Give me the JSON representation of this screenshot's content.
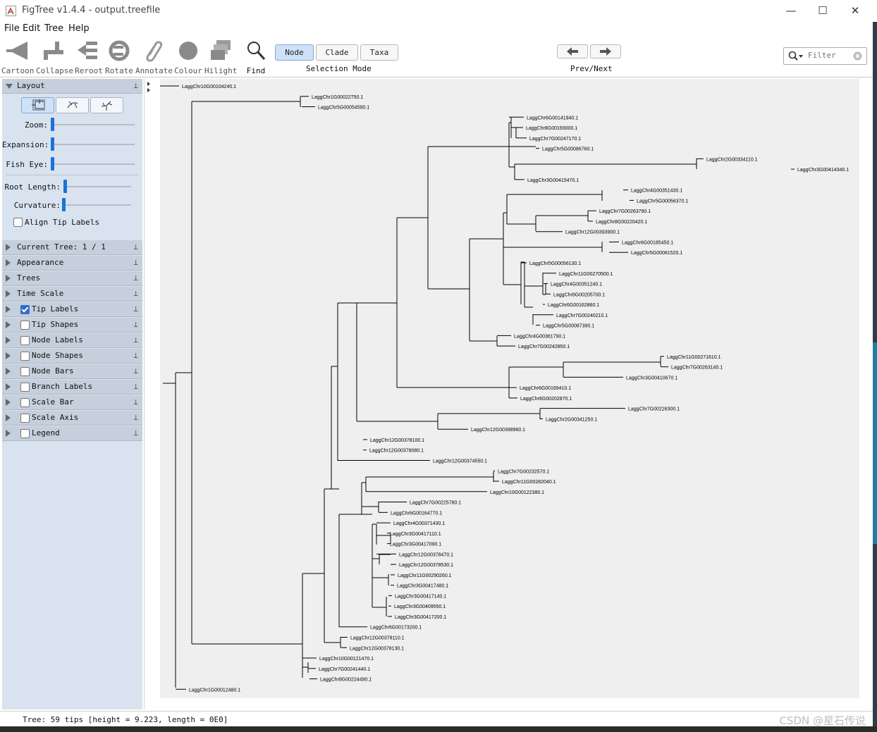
{
  "window": {
    "title": "FigTree v1.4.4 - output.treefile",
    "controls": [
      "—",
      "☐",
      "✕"
    ]
  },
  "menu": [
    "File",
    "Edit",
    "Tree",
    "Help"
  ],
  "toolbar": {
    "tools": [
      "Cartoon",
      "Collapse",
      "Reroot",
      "Rotate",
      "Annotate",
      "Colour",
      "Hilight"
    ],
    "find_label": "Find",
    "selection_mode": {
      "label": "Selection Mode",
      "options": [
        "Node",
        "Clade",
        "Taxa"
      ],
      "selected": "Node"
    },
    "prev_next_label": "Prev/Next",
    "filter_placeholder": "Filter"
  },
  "sidebar": {
    "layout": {
      "header": "Layout",
      "sliders": [
        {
          "label": "Zoom:",
          "value": 0
        },
        {
          "label": "Expansion:",
          "value": 0
        },
        {
          "label": "Fish Eye:",
          "value": 0
        },
        {
          "label": "Root Length:",
          "value": 0.02
        },
        {
          "label": "Curvature:",
          "value": 0
        }
      ],
      "align_tip_labels": "Align Tip Labels",
      "align_checked": false
    },
    "panels": [
      {
        "label": "Current Tree: 1 / 1",
        "checkbox": null
      },
      {
        "label": "Appearance",
        "checkbox": null
      },
      {
        "label": "Trees",
        "checkbox": null
      },
      {
        "label": "Time Scale",
        "checkbox": null
      },
      {
        "label": "Tip Labels",
        "checkbox": true
      },
      {
        "label": "Tip Shapes",
        "checkbox": false
      },
      {
        "label": "Node Labels",
        "checkbox": false
      },
      {
        "label": "Node Shapes",
        "checkbox": false
      },
      {
        "label": "Node Bars",
        "checkbox": false
      },
      {
        "label": "Branch Labels",
        "checkbox": false
      },
      {
        "label": "Scale Bar",
        "checkbox": false
      },
      {
        "label": "Scale Axis",
        "checkbox": false
      },
      {
        "label": "Legend",
        "checkbox": false
      }
    ]
  },
  "tree": {
    "tips": [
      "LaggChr10G00104240.1",
      "LaggChr1G00022750.1",
      "LaggChr5G00054590.1",
      "LaggChr6G00141940.1",
      "LaggChr8G00193000.1",
      "LaggChr7G00247170.1",
      "LaggChr5G00086760.1",
      "LaggChr2G00334110.1",
      "LaggChr3G00414340.1",
      "LaggChr3G00415470.1",
      "LaggChr4G00351430.1",
      "LaggChr5G00056370.1",
      "LaggChr7G00263790.1",
      "LaggChr8G00220420.1",
      "LaggChr12G00393900.1",
      "LaggChr6G00185450.1",
      "LaggChr5G00081520.1",
      "LaggChr5G00056130.1",
      "LaggChr11G00270500.1",
      "LaggChr4G00351240.1",
      "LaggChr8G00205700.1",
      "LaggChr6G00162860.1",
      "LaggChr7G00240210.1",
      "LaggChr5G00087390.1",
      "LaggChr4G00361790.1",
      "LaggChr7G00242850.1",
      "LaggChr11G00271610.1",
      "LaggChr7G00263140.1",
      "LaggChr3G00410670.1",
      "LaggChr6G00169410.1",
      "LaggChr8G00202870.1",
      "LaggChr7G00226300.1",
      "LaggChr2G00341250.1",
      "LaggChr12G00398960.1",
      "LaggChr12G00378100.1",
      "LaggChr12G00378080.1",
      "LaggChr12G00374550.1",
      "LaggChr7G00232570.1",
      "LaggChr11G00282040.1",
      "LaggChr10G00122380.1",
      "LaggChr7G00225780.1",
      "LaggChr6G00164770.1",
      "LaggChr4G00371430.1",
      "LaggChr3G00417110.1",
      "LaggChr3G00417090.1",
      "LaggChr12G00378470.1",
      "LaggChr12G00378530.1",
      "LaggChr11G00290260.1",
      "LaggChr3G00417480.1",
      "LaggChr3G00417140.1",
      "LaggChr3G00409550.1",
      "LaggChr3G00417200.1",
      "LaggChr6G00173200.1",
      "LaggChr12G00378110.1",
      "LaggChr12G00378130.1",
      "LaggChr10G00121470.1",
      "LaggChr7G00241440.1",
      "LaggChr8G00224490.1",
      "LaggChr1G00012480.1"
    ]
  },
  "status": {
    "text": "Tree: 59 tips [height = 9.223, length = 0E0]",
    "watermark": "CSDN @星石传说"
  }
}
